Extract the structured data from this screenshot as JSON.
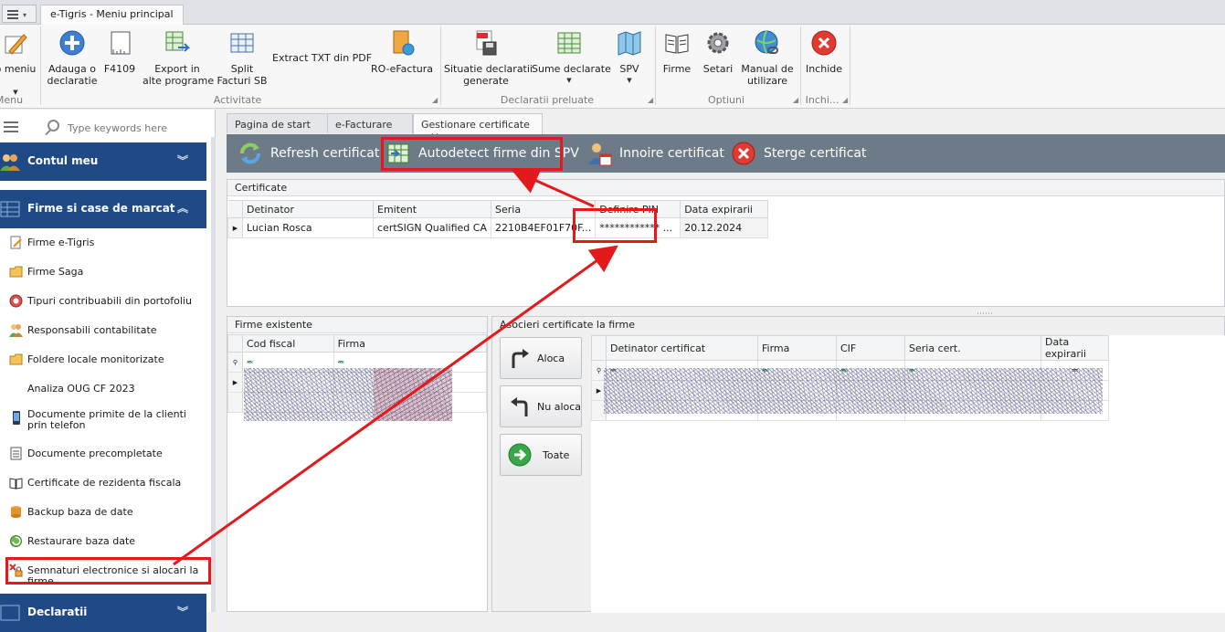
{
  "window": {
    "title_tab": "e-Tigris  - Meniu principal"
  },
  "ribbon": {
    "buttons": [
      {
        "label": "o meniu"
      },
      {
        "label1": "Adauga o",
        "label2": "declaratie"
      },
      {
        "label": "F4109"
      },
      {
        "label1": "Export in",
        "label2": "alte programe"
      },
      {
        "label1": "Split",
        "label2": "Facturi SB"
      },
      {
        "label": "Extract TXT din PDF"
      },
      {
        "label": "RO-eFactura"
      },
      {
        "label1": "Situatie declaratii",
        "label2": "generate"
      },
      {
        "label": "Sume declarate"
      },
      {
        "label": "SPV"
      },
      {
        "label": "Firme"
      },
      {
        "label": "Setari"
      },
      {
        "label1": "Manual de",
        "label2": "utilizare"
      },
      {
        "label": "Inchide"
      }
    ],
    "groups": [
      "Menu",
      "Activitate",
      "Declaratii preluate",
      "Optiuni",
      "Inchi..."
    ]
  },
  "nav": {
    "search_placeholder": "Type keywords here",
    "sections": [
      {
        "label": "Contul meu"
      },
      {
        "label": "Firme si case de marcat"
      },
      {
        "label": "Declaratii"
      }
    ],
    "items": [
      {
        "label": "Firme e-Tigris"
      },
      {
        "label": "Firme Saga"
      },
      {
        "label": "Tipuri contribuabili din portofoliu"
      },
      {
        "label": "Responsabili contabilitate"
      },
      {
        "label": "Foldere locale monitorizate"
      },
      {
        "label": "Analiza OUG CF 2023"
      },
      {
        "label": "Documente primite de la clienti prin telefon"
      },
      {
        "label": "Documente precompletate"
      },
      {
        "label": "Certificate de rezidenta fiscala"
      },
      {
        "label": "Backup baza de date"
      },
      {
        "label": "Restaurare baza date"
      },
      {
        "label": "Semnaturi electronice si alocari la firme"
      }
    ]
  },
  "tabs": [
    {
      "label": "Pagina de start"
    },
    {
      "label": "e-Facturare"
    },
    {
      "label": "Gestionare certificate"
    }
  ],
  "commands": [
    {
      "label": "Refresh certificat"
    },
    {
      "label": "Autodetect firme din SPV"
    },
    {
      "label": "Innoire certificat"
    },
    {
      "label": "Sterge certificat"
    }
  ],
  "certificates": {
    "title": "Certificate",
    "columns": [
      "Detinator",
      "Emitent",
      "Seria",
      "Definire PIN",
      "Data expirarii"
    ],
    "rows": [
      {
        "detinator": "Lucian Rosca",
        "emitent": "certSIGN Qualified CA",
        "seria": "2210B4EF01F70F...",
        "pin": "************ ...",
        "expirare": "20.12.2024"
      }
    ]
  },
  "firme_existente": {
    "title": "Firme existente",
    "columns": [
      "Cod fiscal",
      "Firma"
    ]
  },
  "asocieri": {
    "title": "Asocieri certificate la firme",
    "buttons": [
      {
        "label": "Aloca"
      },
      {
        "label": "Nu aloca"
      },
      {
        "label": "Toate"
      }
    ],
    "columns": [
      "Detinator certificat",
      "Firma",
      "CIF",
      "Seria cert.",
      "Data expirarii"
    ]
  },
  "colors": {
    "nav_header": "#1f4a86",
    "cmd_bar": "#6d7a88",
    "annotation": "#e3191c"
  }
}
